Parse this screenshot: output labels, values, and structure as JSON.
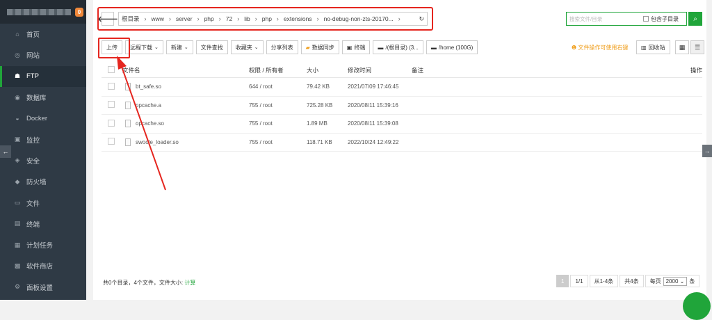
{
  "sidebar": {
    "badge_count": "0",
    "items": [
      {
        "label": "首页",
        "icon": "home-icon",
        "glyph": "⌂"
      },
      {
        "label": "网站",
        "icon": "globe-icon",
        "glyph": "◎"
      },
      {
        "label": "FTP",
        "icon": "user-icon",
        "glyph": "☗",
        "active": true
      },
      {
        "label": "数据库",
        "icon": "database-icon",
        "glyph": "◉"
      },
      {
        "label": "Docker",
        "icon": "docker-icon",
        "glyph": "◒"
      },
      {
        "label": "监控",
        "icon": "monitor-icon",
        "glyph": "▣"
      },
      {
        "label": "安全",
        "icon": "shield-icon",
        "glyph": "◈"
      },
      {
        "label": "防火墙",
        "icon": "firewall-icon",
        "glyph": "◆"
      },
      {
        "label": "文件",
        "icon": "folder-icon",
        "glyph": "▭"
      },
      {
        "label": "终端",
        "icon": "terminal-icon",
        "glyph": "▤"
      },
      {
        "label": "计划任务",
        "icon": "calendar-icon",
        "glyph": "▦"
      },
      {
        "label": "软件商店",
        "icon": "apps-icon",
        "glyph": "▩"
      },
      {
        "label": "面板设置",
        "icon": "gear-icon",
        "glyph": "⚙"
      }
    ]
  },
  "breadcrumb": [
    "根目录",
    "www",
    "server",
    "php",
    "72",
    "lib",
    "php",
    "extensions",
    "no-debug-non-zts-20170..."
  ],
  "search": {
    "placeholder": "搜索文件/目录",
    "include_sub_label": "包含子目录"
  },
  "toolbar": {
    "upload": "上传",
    "remote_download": "远程下载",
    "new": "新建",
    "find": "文件查找",
    "favorites": "收藏夹",
    "share_list": "分享列表",
    "data_sync": "数据同步",
    "terminal": "终端",
    "disk_root": "/(根目录) (3...",
    "disk_home": "/home (100G)"
  },
  "tip": "文件操作可使用右键",
  "recycle": "回收站",
  "table": {
    "headers": {
      "name": "文件名",
      "perm": "权限 / 所有者",
      "size": "大小",
      "mtime": "修改时间",
      "note": "备注",
      "ops": "操作"
    },
    "rows": [
      {
        "name": "bt_safe.so",
        "perm": "644 / root",
        "size": "79.42 KB",
        "mtime": "2021/07/09 17:46:45"
      },
      {
        "name": "opcache.a",
        "perm": "755 / root",
        "size": "725.28 KB",
        "mtime": "2020/08/11 15:39:16"
      },
      {
        "name": "opcache.so",
        "perm": "755 / root",
        "size": "1.89 MB",
        "mtime": "2020/08/11 15:39:08"
      },
      {
        "name": "swoole_loader.so",
        "perm": "755 / root",
        "size": "118.71 KB",
        "mtime": "2022/10/24 12:49:22"
      }
    ]
  },
  "footer": {
    "summary": "共0个目录，4个文件，文件大小:",
    "calc": "计算",
    "pager": {
      "current": "1",
      "pages": "1/1",
      "range": "从1-4条",
      "total": "共4条",
      "per_page_label": "每页",
      "per_page": "2000",
      "unit": "条"
    }
  },
  "colors": {
    "brand": "#20a53a",
    "annotation": "#e5261f",
    "sidebar_bg": "#2f3a45"
  }
}
